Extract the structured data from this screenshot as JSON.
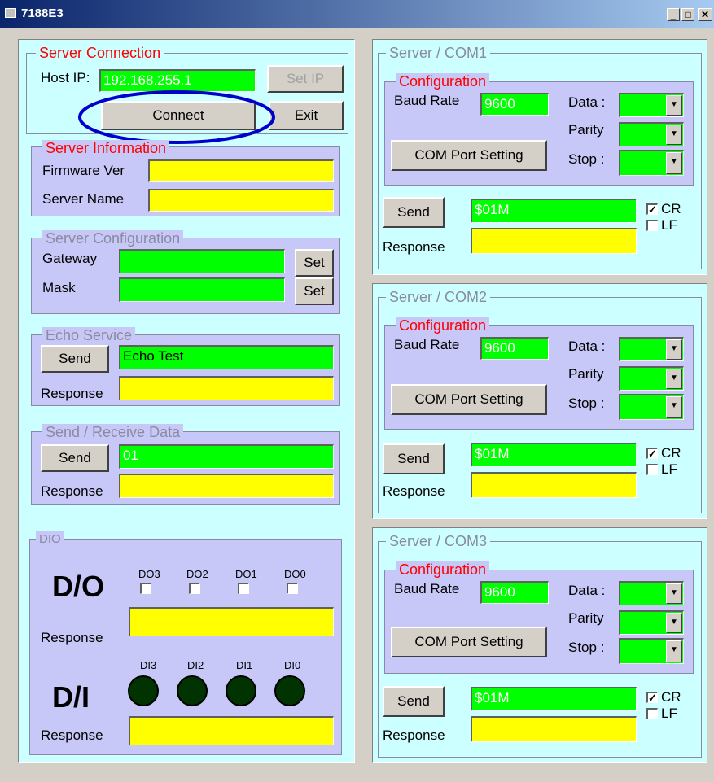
{
  "window": {
    "title": "7188E3",
    "minimize": "_",
    "maximize": "□",
    "close": "✕"
  },
  "server_connection": {
    "legend": "Server Connection",
    "host_ip_label": "Host IP:",
    "host_ip_value": "192.168.255.1",
    "set_ip_label": "Set IP",
    "connect_label": "Connect",
    "exit_label": "Exit"
  },
  "server_information": {
    "legend": "Server Information",
    "firmware_label": "Firmware Ver",
    "firmware_value": "",
    "server_name_label": "Server Name",
    "server_name_value": ""
  },
  "server_configuration": {
    "legend": "Server Configuration",
    "gateway_label": "Gateway",
    "gateway_value": "",
    "mask_label": "Mask",
    "mask_value": "",
    "set_label": "Set"
  },
  "echo_service": {
    "legend": "Echo Service",
    "send_label": "Send",
    "input_value": "Echo Test",
    "response_label": "Response",
    "response_value": ""
  },
  "send_receive": {
    "legend": "Send / Receive Data",
    "send_label": "Send",
    "input_value": "01",
    "response_label": "Response",
    "response_value": ""
  },
  "dio": {
    "legend": "DIO",
    "do_title": "D/O",
    "do_labels": [
      "DO3",
      "DO2",
      "DO1",
      "DO0"
    ],
    "do_response_label": "Response",
    "di_title": "D/I",
    "di_labels": [
      "DI3",
      "DI2",
      "DI1",
      "DI0"
    ],
    "di_response_label": "Response"
  },
  "com_panels": [
    {
      "legend": "Server / COM1",
      "config_legend": "Configuration",
      "baud_label": "Baud Rate",
      "baud_value": "9600",
      "data_label": "Data :",
      "parity_label": "Parity",
      "stop_label": "Stop :",
      "com_setting_label": "COM Port Setting",
      "send_label": "Send",
      "send_value": "$01M",
      "cr_label": "CR",
      "cr_checked": "✓",
      "lf_label": "LF",
      "response_label": "Response"
    },
    {
      "legend": "Server / COM2",
      "config_legend": "Configuration",
      "baud_label": "Baud Rate",
      "baud_value": "9600",
      "data_label": "Data :",
      "parity_label": "Parity",
      "stop_label": "Stop :",
      "com_setting_label": "COM Port Setting",
      "send_label": "Send",
      "send_value": "$01M",
      "cr_label": "CR",
      "cr_checked": "✓",
      "lf_label": "LF",
      "response_label": "Response"
    },
    {
      "legend": "Server / COM3",
      "config_legend": "Configuration",
      "baud_label": "Baud Rate",
      "baud_value": "9600",
      "data_label": "Data :",
      "parity_label": "Parity",
      "stop_label": "Stop :",
      "com_setting_label": "COM Port Setting",
      "send_label": "Send",
      "send_value": "$01M",
      "cr_label": "CR",
      "cr_checked": "✓",
      "lf_label": "LF",
      "response_label": "Response"
    }
  ],
  "colors": {
    "title_bar": "#0a246a",
    "panel_bg": "#ccffff",
    "group_bg": "#c8c8f8",
    "field_green": "#00ff00",
    "field_yellow": "#ffff00",
    "legend_red": "#ff0000",
    "highlight_ellipse": "#0000cc"
  }
}
